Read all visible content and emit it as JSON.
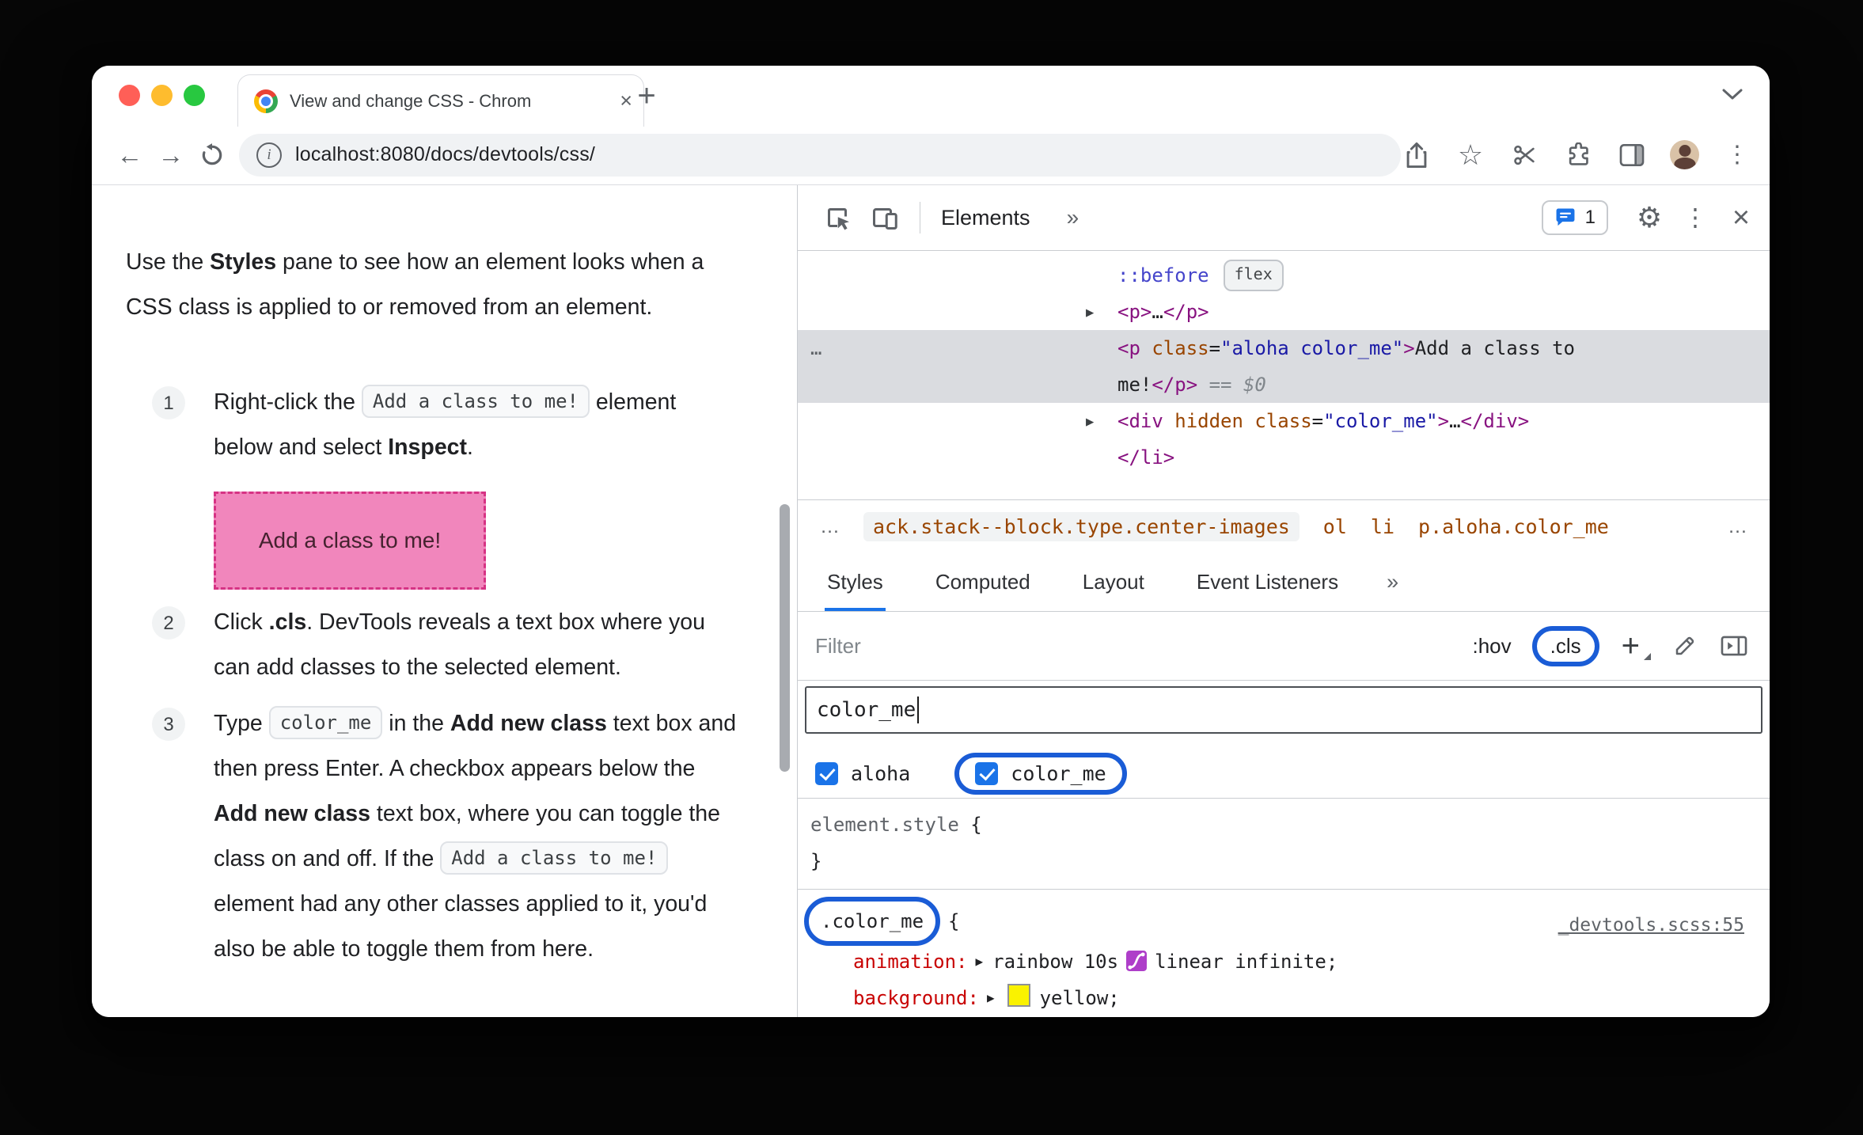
{
  "icons": {
    "back": "←",
    "forward": "→",
    "plus": "+",
    "close": "×",
    "kebab": "⋮",
    "gear": "⚙",
    "star": "☆",
    "more": "»",
    "expand": "▶",
    "ellipsis": "…"
  },
  "tab": {
    "title": "View and change CSS - Chrom"
  },
  "address": {
    "url": "localhost:8080/docs/devtools/css/"
  },
  "doc": {
    "intro": {
      "s1": "Use the ",
      "b1": "Styles",
      "s2": " pane to see how an element looks when a CSS class is applied to or removed from an element."
    },
    "steps": [
      {
        "num": "1",
        "s1": "Right-click the ",
        "code1": "Add a class to me!",
        "s2": " element below and select ",
        "b1": "Inspect",
        "s3": "."
      },
      {
        "num": "2",
        "s1": "Click ",
        "b1": ".cls",
        "s2": ". DevTools reveals a text box where you can add classes to the selected element."
      },
      {
        "num": "3",
        "s1": "Type ",
        "code1": "color_me",
        "s2": " in the ",
        "b1": "Add new class",
        "s3": " text box and then press Enter. A checkbox appears below the ",
        "b2": "Add new class",
        "s4": " text box, where you can toggle the class on and off. If the ",
        "code2": "Add a class to me!",
        "s5": " element had any other classes applied to it, you'd also be able to toggle them from here."
      }
    ],
    "demo_box": "Add a class to me!"
  },
  "devtools": {
    "toolbar": {
      "panel_tab": "Elements",
      "badge_count": "1"
    },
    "tree": {
      "pseudo": "::before",
      "badge": "flex",
      "p_collapsed": {
        "open": "<p>",
        "dots": "…",
        "close": "</p>"
      },
      "selected": {
        "gutter": "…",
        "tag_open": "<p ",
        "attr": "class",
        "eq": "=",
        "val": "\"aloha color_me\"",
        "gt": ">",
        "text1": "Add a class to",
        "text2": "me!",
        "tag_close": "</p>",
        "marker": " == ",
        "dollar": "$0"
      },
      "div_row": {
        "tag_open": "<div ",
        "attr1": "hidden ",
        "attr2": "class",
        "eq": "=",
        "val": "\"color_me\"",
        "gt": ">",
        "dots": "…",
        "tag_close": "</div>"
      },
      "li_close": "</li>"
    },
    "crumbs": {
      "lead": "…",
      "c1": "ack.stack--block.type.center-images",
      "c2": "ol",
      "c3": "li",
      "c4": "p.aloha.color_me",
      "trail": "…"
    },
    "tabs": [
      "Styles",
      "Computed",
      "Layout",
      "Event Listeners"
    ],
    "filter": {
      "placeholder": "Filter",
      "hov": ":hov",
      "cls": ".cls"
    },
    "add_class": {
      "value": "color_me"
    },
    "classes": [
      {
        "label": "aloha"
      },
      {
        "label": "color_me"
      }
    ],
    "element_style": {
      "name": "element.style",
      "open": "{",
      "close": "}"
    },
    "rule": {
      "selector": ".color_me",
      "open": "{",
      "source": "_devtools.scss:55",
      "props": [
        {
          "name": "animation:",
          "v1": "rainbow 10s",
          "v2": "linear infinite;"
        },
        {
          "name": "background:",
          "v1": "yellow;"
        }
      ],
      "close": "}"
    },
    "colors": {
      "annotation": "#1A5CD6",
      "accent": "#1A73E8",
      "selected_row": "#DADCE0",
      "swatch": "#FAF200"
    }
  }
}
